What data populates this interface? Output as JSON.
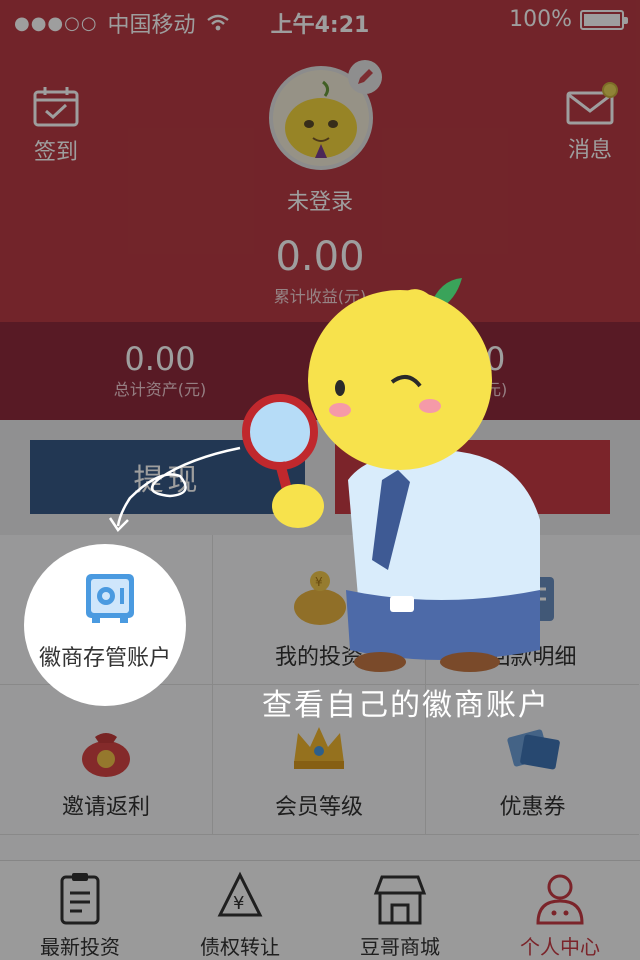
{
  "status_bar": {
    "carrier": "中国移动",
    "time": "上午4:21",
    "battery": "100%",
    "battery_level": 1.0
  },
  "header": {
    "checkin_label": "签到",
    "messages_label": "消息",
    "login_status": "未登录",
    "earnings_value": "0.00",
    "earnings_label": "累计收益(元)"
  },
  "stats": {
    "total_assets_value": "0.00",
    "total_assets_label": "总计资产(元)",
    "balance_value": "00",
    "balance_label": "额(元)"
  },
  "actions": {
    "withdraw_label": "提现"
  },
  "grid": [
    {
      "label": "徽商存管账户",
      "icon": "safe-icon"
    },
    {
      "label": "我的投资",
      "icon": "piggy-bank-icon"
    },
    {
      "label": "回款明细",
      "icon": "ledger-icon"
    },
    {
      "label": "邀请返利",
      "icon": "money-bag-icon"
    },
    {
      "label": "会员等级",
      "icon": "crown-icon"
    },
    {
      "label": "优惠券",
      "icon": "coupon-icon"
    }
  ],
  "tabs": [
    {
      "label": "最新投资",
      "icon": "clipboard-icon",
      "active": false
    },
    {
      "label": "债权转让",
      "icon": "recycle-yen-icon",
      "active": false
    },
    {
      "label": "豆哥商城",
      "icon": "shop-icon",
      "active": false
    },
    {
      "label": "个人中心",
      "icon": "person-icon",
      "active": true
    }
  ],
  "overlay": {
    "hint": "查看自己的徽商账户",
    "highlighted_item": "徽商存管账户"
  },
  "colors": {
    "header": "#b83b44",
    "stats": "#8f2b3c",
    "withdraw": "#385a86",
    "recharge": "#c73b45",
    "active_tab": "#c73b45"
  }
}
